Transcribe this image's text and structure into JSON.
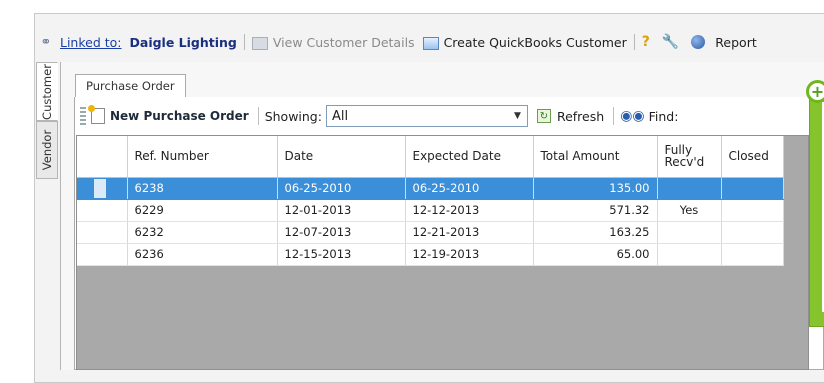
{
  "linkbar": {
    "chain_icon": "chain-link-icon",
    "linked_label": "Linked to:",
    "company": "Daigle Lighting",
    "view_details": "View Customer Details",
    "create_qb": "Create QuickBooks Customer",
    "help_icon": "?",
    "report": "Report"
  },
  "side_tabs": [
    "Customer",
    "Vendor"
  ],
  "tabs": [
    "Purchase Order"
  ],
  "toolbar": {
    "new_po": "New Purchase Order",
    "showing_label": "Showing:",
    "showing_value": "All",
    "refresh": "Refresh",
    "find": "Find:"
  },
  "grid": {
    "columns": [
      "Ref. Number",
      "Date",
      "Expected Date",
      "Total Amount",
      "Fully Recv'd",
      "Closed"
    ],
    "rows": [
      {
        "ref": "6238",
        "date": "06-25-2010",
        "expected": "06-25-2010",
        "total": "135.00",
        "received": "",
        "closed": "",
        "selected": true
      },
      {
        "ref": "6229",
        "date": "12-01-2013",
        "expected": "12-12-2013",
        "total": "571.32",
        "received": "Yes",
        "closed": ""
      },
      {
        "ref": "6232",
        "date": "12-07-2013",
        "expected": "12-21-2013",
        "total": "163.25",
        "received": "",
        "closed": ""
      },
      {
        "ref": "6236",
        "date": "12-15-2013",
        "expected": "12-19-2013",
        "total": "65.00",
        "received": "",
        "closed": ""
      }
    ]
  },
  "colors": {
    "selected_row": "#3b8ed8",
    "link": "#1a3fa5",
    "callout_green": "#86c42d"
  },
  "callout": {
    "icon": "plus-circle-icon",
    "symbol": "+"
  }
}
